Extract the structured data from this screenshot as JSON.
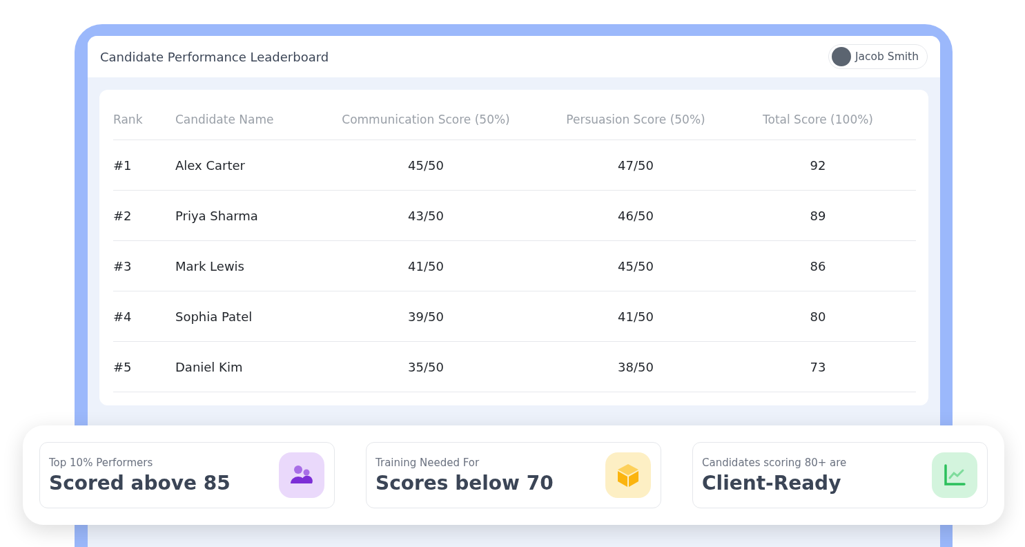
{
  "header": {
    "title": "Candidate Performance Leaderboard",
    "user": {
      "name": "Jacob Smith"
    }
  },
  "table": {
    "columns": [
      "Rank",
      "Candidate Name",
      "Communication Score (50%)",
      "Persuasion Score (50%)",
      "Total Score (100%)"
    ],
    "rows": [
      [
        "#1",
        "Alex Carter",
        "45/50",
        "47/50",
        "92"
      ],
      [
        "#2",
        "Priya Sharma",
        "43/50",
        "46/50",
        "89"
      ],
      [
        "#3",
        "Mark Lewis",
        "41/50",
        "45/50",
        "86"
      ],
      [
        "#4",
        "Sophia Patel",
        "39/50",
        "41/50",
        "80"
      ],
      [
        "#5",
        "Daniel Kim",
        "35/50",
        "38/50",
        "73"
      ]
    ]
  },
  "stats": [
    {
      "label": "Top 10% Performers",
      "value": "Scored above 85",
      "kind": "people"
    },
    {
      "label": "Training Needed For",
      "value": "Scores below 70",
      "kind": "box"
    },
    {
      "label": "Candidates scoring 80+ are",
      "value": "Client-Ready",
      "kind": "chart"
    }
  ]
}
